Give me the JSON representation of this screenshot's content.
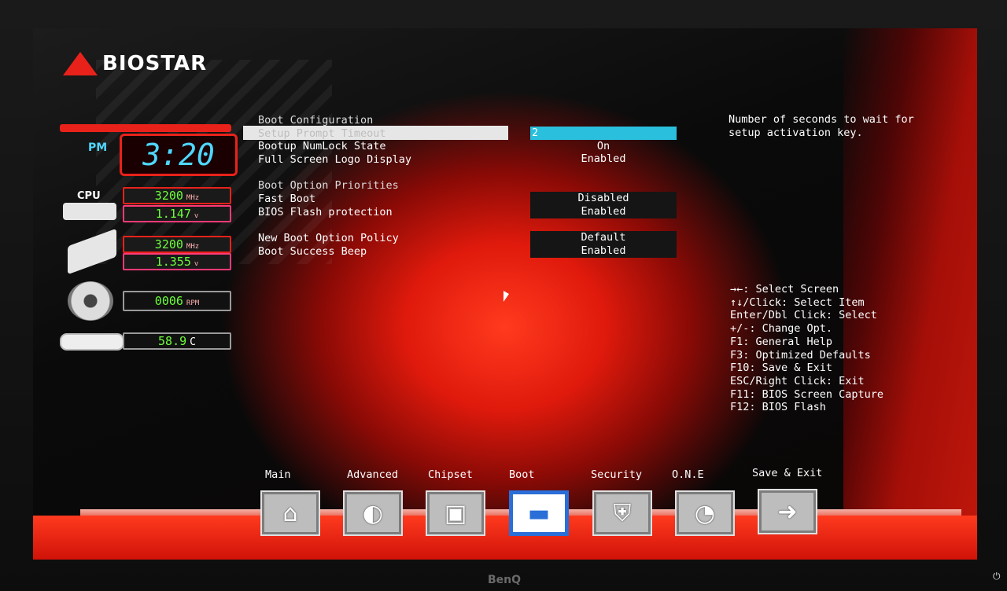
{
  "brand": {
    "logo_text": "BIOSTAR",
    "monitor_brand": "BenQ"
  },
  "status": {
    "ampm": "PM",
    "clock": "3:20",
    "cpu_label": "CPU",
    "cpu_freq": "3200",
    "cpu_freq_unit": "MHz",
    "cpu_volt": "1.147",
    "cpu_volt_unit": "v",
    "mem_freq": "3200",
    "mem_freq_unit": "MHz",
    "mem_volt": "1.355",
    "mem_volt_unit": "v",
    "fan_rpm": "0006",
    "fan_rpm_unit": "RPM",
    "temp": "58.9",
    "temp_unit": "C"
  },
  "menu": {
    "heading_boot_config": "Boot Configuration",
    "setup_prompt_timeout": {
      "label": "Setup Prompt Timeout",
      "value": "2"
    },
    "bootup_numlock": {
      "label": "Bootup NumLock State",
      "value": "On"
    },
    "full_screen_logo": {
      "label": "Full Screen Logo Display",
      "value": "Enabled"
    },
    "heading_boot_priorities": "Boot Option Priorities",
    "fast_boot": {
      "label": "Fast Boot",
      "value": "Disabled"
    },
    "bios_flash_protection": {
      "label": "BIOS Flash protection",
      "value": "Enabled"
    },
    "new_boot_option_policy": {
      "label": "New Boot Option Policy",
      "value": "Default"
    },
    "boot_success_beep": {
      "label": "Boot Success Beep",
      "value": "Enabled"
    }
  },
  "help": {
    "description": "Number of seconds to wait for setup activation key.",
    "keys": [
      "→←: Select Screen",
      "↑↓/Click: Select Item",
      "Enter/Dbl Click: Select",
      "+/-: Change Opt.",
      "F1: General Help",
      "F3: Optimized Defaults",
      "F10: Save & Exit",
      "ESC/Right Click: Exit",
      "F11: BIOS Screen Capture",
      "F12: BIOS Flash"
    ]
  },
  "tabs": [
    {
      "label": "Main",
      "icon": "home-icon",
      "glyph": "⌂"
    },
    {
      "label": "Advanced",
      "icon": "joystick-icon",
      "glyph": "◐"
    },
    {
      "label": "Chipset",
      "icon": "chip-icon",
      "glyph": "▣"
    },
    {
      "label": "Boot",
      "icon": "drive-icon",
      "glyph": "▬",
      "active": true
    },
    {
      "label": "Security",
      "icon": "shield-icon",
      "glyph": "⛨"
    },
    {
      "label": "O.N.E",
      "icon": "gauge-icon",
      "glyph": "◔"
    },
    {
      "label": "Save & Exit",
      "icon": "exit-icon",
      "glyph": "➜"
    }
  ],
  "colors": {
    "accent": "#e8221a",
    "selection": "#2ac0dd",
    "active_tab": "#2a6ed8",
    "readout": "#6cff3a",
    "clock": "#4fd7ff"
  }
}
